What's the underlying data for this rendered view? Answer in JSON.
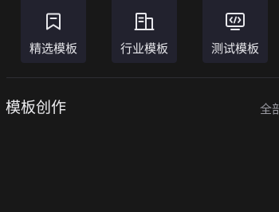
{
  "categories": [
    {
      "label": "精选模板",
      "icon": "bookmark-icon"
    },
    {
      "label": "行业模板",
      "icon": "building-icon"
    },
    {
      "label": "测试模板",
      "icon": "code-icon"
    }
  ],
  "section": {
    "title": "模板创作",
    "view_all_label": "全部"
  },
  "colors": {
    "background": "#181818",
    "card_background": "#22222e",
    "text_primary": "#e6e6ea",
    "text_secondary": "#9a9aa2",
    "divider": "#2e2e34"
  }
}
